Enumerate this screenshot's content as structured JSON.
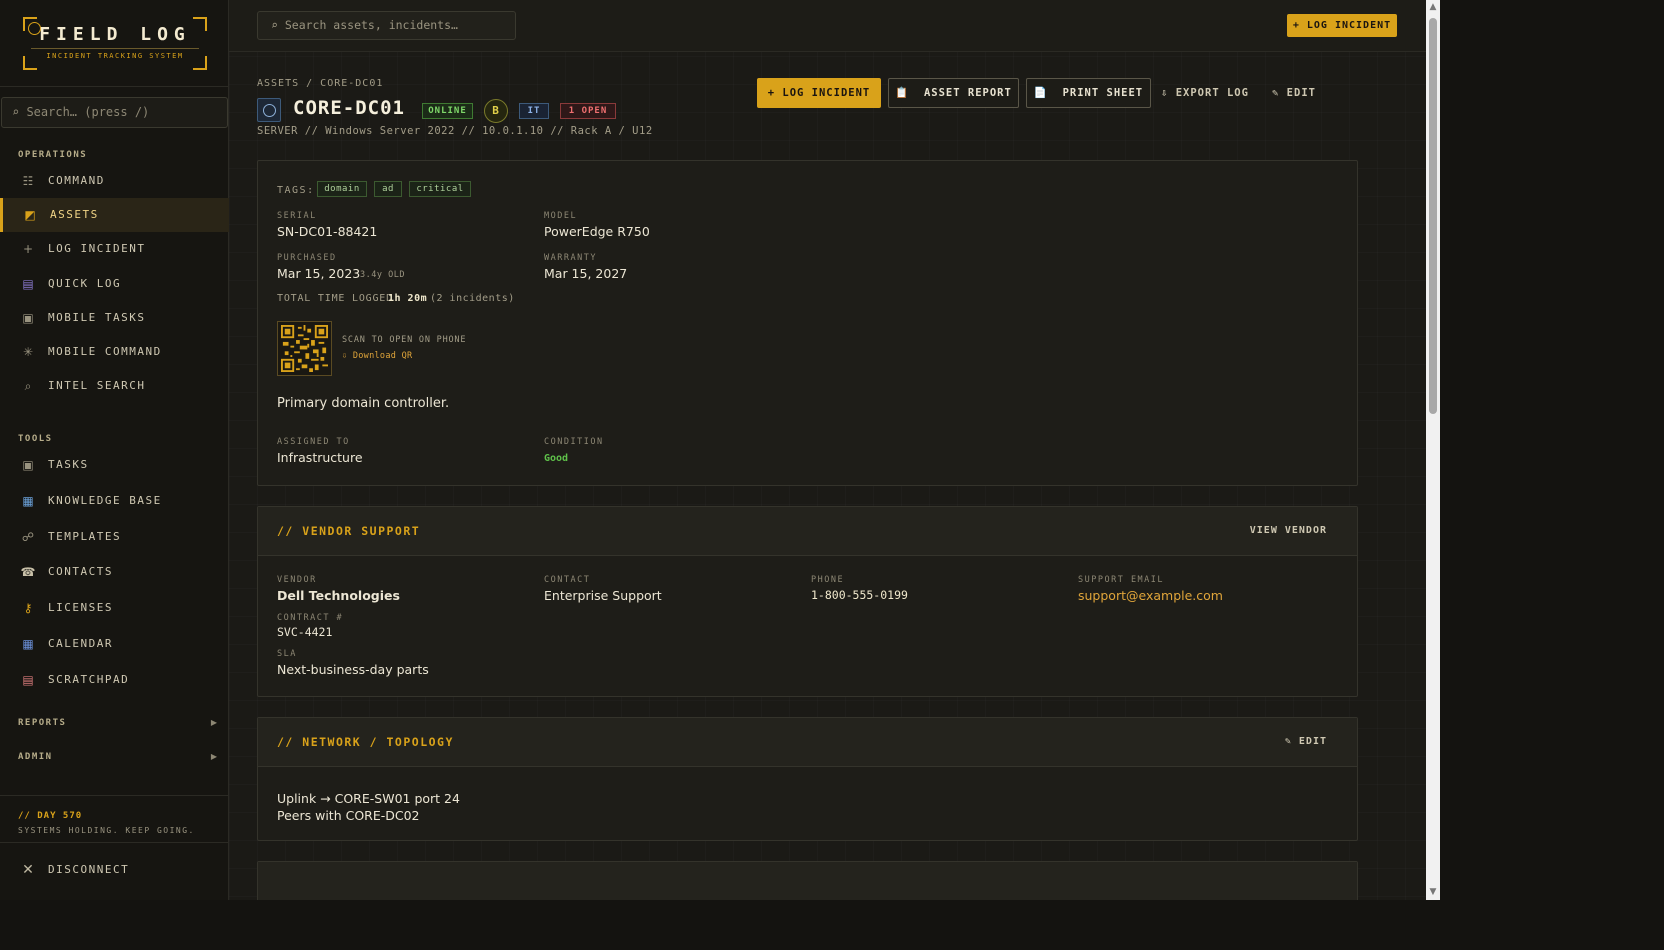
{
  "sidebar": {
    "logo_title": "FIELD LOG",
    "logo_subtitle": "INCIDENT TRACKING SYSTEM",
    "search_placeholder": "⌕ Search… (press /)",
    "section_operations": "OPERATIONS",
    "section_tools": "TOOLS",
    "operations": [
      {
        "label": "COMMAND",
        "icon": "grid-list-icon"
      },
      {
        "label": "ASSETS",
        "icon": "asset-icon",
        "active": true
      },
      {
        "label": "LOG INCIDENT",
        "icon": "plus-icon"
      },
      {
        "label": "QUICK LOG",
        "icon": "notebook-icon"
      },
      {
        "label": "MOBILE TASKS",
        "icon": "checkbox-icon"
      },
      {
        "label": "MOBILE COMMAND",
        "icon": "star-burst-icon"
      },
      {
        "label": "INTEL SEARCH",
        "icon": "search-icon"
      }
    ],
    "tools": [
      {
        "label": "TASKS",
        "icon": "checkbox-icon"
      },
      {
        "label": "KNOWLEDGE BASE",
        "icon": "books-icon"
      },
      {
        "label": "TEMPLATES",
        "icon": "link-icon"
      },
      {
        "label": "CONTACTS",
        "icon": "phone-icon"
      },
      {
        "label": "LICENSES",
        "icon": "key-icon"
      },
      {
        "label": "CALENDAR",
        "icon": "calendar-icon"
      },
      {
        "label": "SCRATCHPAD",
        "icon": "memo-icon"
      }
    ],
    "groups": [
      "REPORTS",
      "ADMIN"
    ],
    "day_title": "// DAY 570",
    "day_subtitle": "SYSTEMS HOLDING. KEEP GOING.",
    "disconnect_label": "DISCONNECT"
  },
  "topbar": {
    "search_placeholder": "⌕ Search assets, incidents…",
    "log_incident_label": "+ LOG INCIDENT"
  },
  "asset": {
    "breadcrumb": "ASSETS / CORE-DC01",
    "name": "CORE-DC01",
    "status": "ONLINE",
    "grade": "B",
    "category": "IT",
    "open_count": "1 OPEN",
    "meta": "SERVER // Windows Server 2022 // 10.0.1.10 // Rack A / U12",
    "actions": {
      "log_incident": "+ LOG INCIDENT",
      "asset_report": "ASSET REPORT",
      "print_sheet": "PRINT SHEET",
      "export_log": "EXPORT LOG",
      "edit": "EDIT"
    }
  },
  "details": {
    "tags_label": "TAGS:",
    "tags": [
      "domain",
      "ad",
      "critical"
    ],
    "serial_label": "SERIAL",
    "serial": "SN-DC01-88421",
    "model_label": "MODEL",
    "model": "PowerEdge R750",
    "purchased_label": "PURCHASED",
    "purchased": "Mar 15, 2023",
    "age": "3.4y OLD",
    "warranty_label": "WARRANTY",
    "warranty": "Mar 15, 2027",
    "time_logged_label": "TOTAL TIME LOGGED:",
    "time_logged": "1h 20m",
    "incident_count": "(2 incidents)",
    "qr_caption": "SCAN TO OPEN ON PHONE",
    "qr_download": "⇩ Download QR",
    "description": "Primary domain controller.",
    "assigned_label": "ASSIGNED TO",
    "assigned": "Infrastructure",
    "condition_label": "CONDITION",
    "condition": "Good"
  },
  "vendor": {
    "title": "// VENDOR SUPPORT",
    "action": "VIEW VENDOR",
    "vendor_label": "VENDOR",
    "vendor": "Dell Technologies",
    "contact_label": "CONTACT",
    "contact": "Enterprise Support",
    "phone_label": "PHONE",
    "phone": "1-800-555-0199",
    "email_label": "SUPPORT EMAIL",
    "email": "support@example.com",
    "contract_label": "CONTRACT #",
    "contract": "SVC-4421",
    "sla_label": "SLA",
    "sla": "Next-business-day parts"
  },
  "network": {
    "title": "// NETWORK / TOPOLOGY",
    "action": "EDIT",
    "lines": [
      "Uplink → CORE-SW01 port 24",
      "Peers with CORE-DC02"
    ]
  },
  "colors": {
    "accent": "#d9a21a",
    "online": "#7fd86a",
    "open": "#f07070",
    "link": "#e0a53a",
    "good": "#5fc24a"
  }
}
